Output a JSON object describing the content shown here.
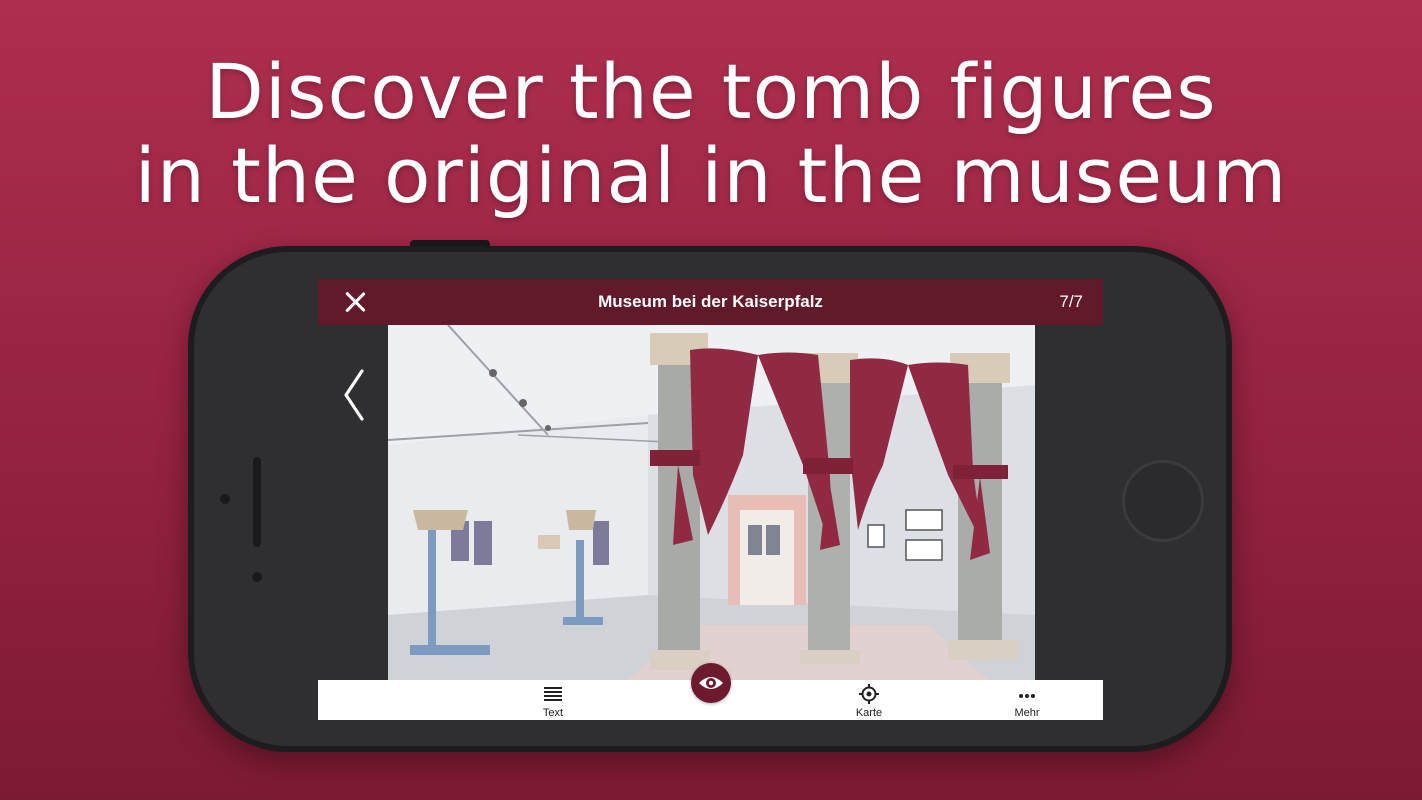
{
  "headline": {
    "line1": "Discover the tomb figures",
    "line2": "in the original in the museum"
  },
  "app": {
    "title": "Museum bei der Kaiserpfalz",
    "counter": "7/7",
    "close_icon": "close-icon",
    "back_icon": "chevron-left-icon"
  },
  "tabs": [
    {
      "label": "Text",
      "icon": "text-lines-icon"
    },
    {
      "label": "",
      "icon": "eye-icon"
    },
    {
      "label": "Karte",
      "icon": "location-target-icon"
    },
    {
      "label": "Mehr",
      "icon": "more-dots-icon"
    }
  ],
  "colors": {
    "background": "#9a2444",
    "topbar": "#621a2b",
    "accent": "#6d1a2e",
    "curtain": "#8f2a42"
  }
}
